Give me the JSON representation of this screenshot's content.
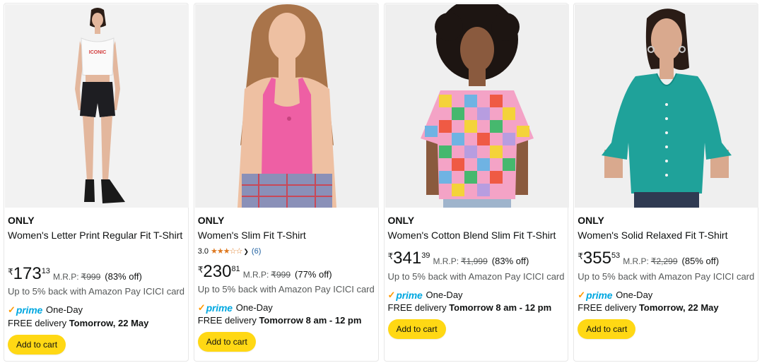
{
  "colors": {
    "accent_button": "#ffd814",
    "prime_blue": "#00a8e1",
    "prime_check": "#ff9900",
    "star": "#de7921",
    "link": "#2162a1"
  },
  "products": [
    {
      "brand": "ONLY",
      "title": "Women's Letter Print Regular Fit T-Shirt",
      "price_symbol": "₹",
      "price_whole": "173",
      "price_fraction": "13",
      "mrp_label": "M.R.P:",
      "mrp_value": "₹999",
      "discount": "(83% off)",
      "cashback": "Up to 5% back with Amazon Pay ICICI card",
      "prime_label": "One-Day",
      "delivery_prefix": "FREE delivery ",
      "delivery_when": "Tomorrow, 22 May",
      "cart_label": "Add to cart",
      "image_desc_icon": "woman-white-crop-top-photo",
      "top_text": "ICONIC"
    },
    {
      "brand": "ONLY",
      "title": "Women's Slim Fit T-Shirt",
      "rating_value": "3.0",
      "rating_stars": 3,
      "rating_count": "(6)",
      "price_symbol": "₹",
      "price_whole": "230",
      "price_fraction": "81",
      "mrp_label": "M.R.P:",
      "mrp_value": "₹999",
      "discount": "(77% off)",
      "cashback": "Up to 5% back with Amazon Pay ICICI card",
      "prime_label": "One-Day",
      "delivery_prefix": "FREE delivery ",
      "delivery_when": "Tomorrow 8 am - 12 pm",
      "cart_label": "Add to cart",
      "image_desc_icon": "woman-pink-tank-photo"
    },
    {
      "brand": "ONLY",
      "title": "Women's Cotton Blend Slim Fit T-Shirt",
      "price_symbol": "₹",
      "price_whole": "341",
      "price_fraction": "39",
      "mrp_label": "M.R.P:",
      "mrp_value": "₹1,999",
      "discount": "(83% off)",
      "cashback": "Up to 5% back with Amazon Pay ICICI card",
      "prime_label": "One-Day",
      "delivery_prefix": "FREE delivery ",
      "delivery_when": "Tomorrow 8 am - 12 pm",
      "cart_label": "Add to cart",
      "image_desc_icon": "woman-checkered-tee-photo"
    },
    {
      "brand": "ONLY",
      "title": "Women's Solid Relaxed Fit T-Shirt",
      "price_symbol": "₹",
      "price_whole": "355",
      "price_fraction": "53",
      "mrp_label": "M.R.P:",
      "mrp_value": "₹2,299",
      "discount": "(85% off)",
      "cashback": "Up to 5% back with Amazon Pay ICICI card",
      "prime_label": "One-Day",
      "delivery_prefix": "FREE delivery ",
      "delivery_when": "Tomorrow, 22 May",
      "cart_label": "Add to cart",
      "image_desc_icon": "woman-teal-top-photo"
    }
  ],
  "prime_logo": {
    "check": "✓",
    "word": "prime"
  }
}
